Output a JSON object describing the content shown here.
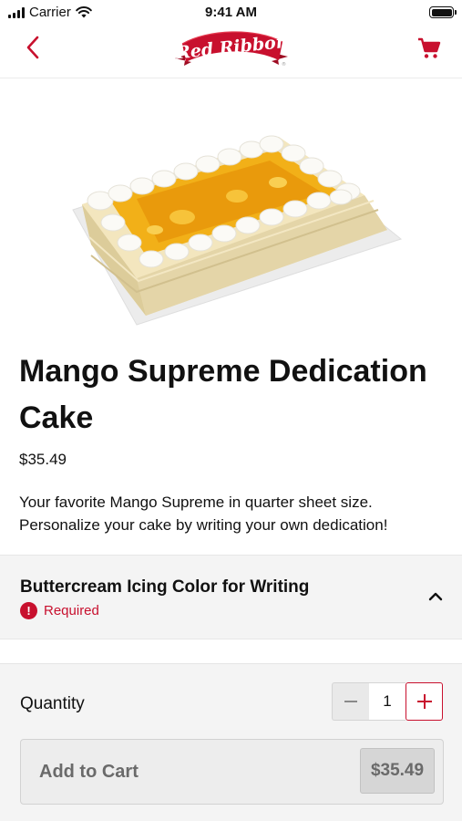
{
  "status_bar": {
    "carrier": "Carrier",
    "time": "9:41 AM",
    "icons": [
      "signal-icon",
      "wifi-icon",
      "battery-icon"
    ]
  },
  "nav": {
    "back_icon": "chevron-left-icon",
    "logo_text": "Red Ribbon",
    "cart_icon": "cart-icon",
    "accent_color": "#c8102e"
  },
  "product": {
    "image": "mango-cake-image",
    "title": "Mango Supreme Dedication Cake",
    "price": "$35.49",
    "description": "Your favorite Mango Supreme in quarter sheet size. Personalize your cake by writing your own dedication!"
  },
  "option": {
    "title": "Buttercream Icing Color for Writing",
    "required_label": "Required",
    "required_icon": "exclamation-circle-icon",
    "expand_icon": "chevron-up-icon",
    "required_color": "#c8102e"
  },
  "cart": {
    "quantity_label": "Quantity",
    "quantity_value": "1",
    "minus_icon": "minus-icon",
    "plus_icon": "plus-icon",
    "add_button_label": "Add to Cart",
    "add_button_price": "$35.49"
  }
}
